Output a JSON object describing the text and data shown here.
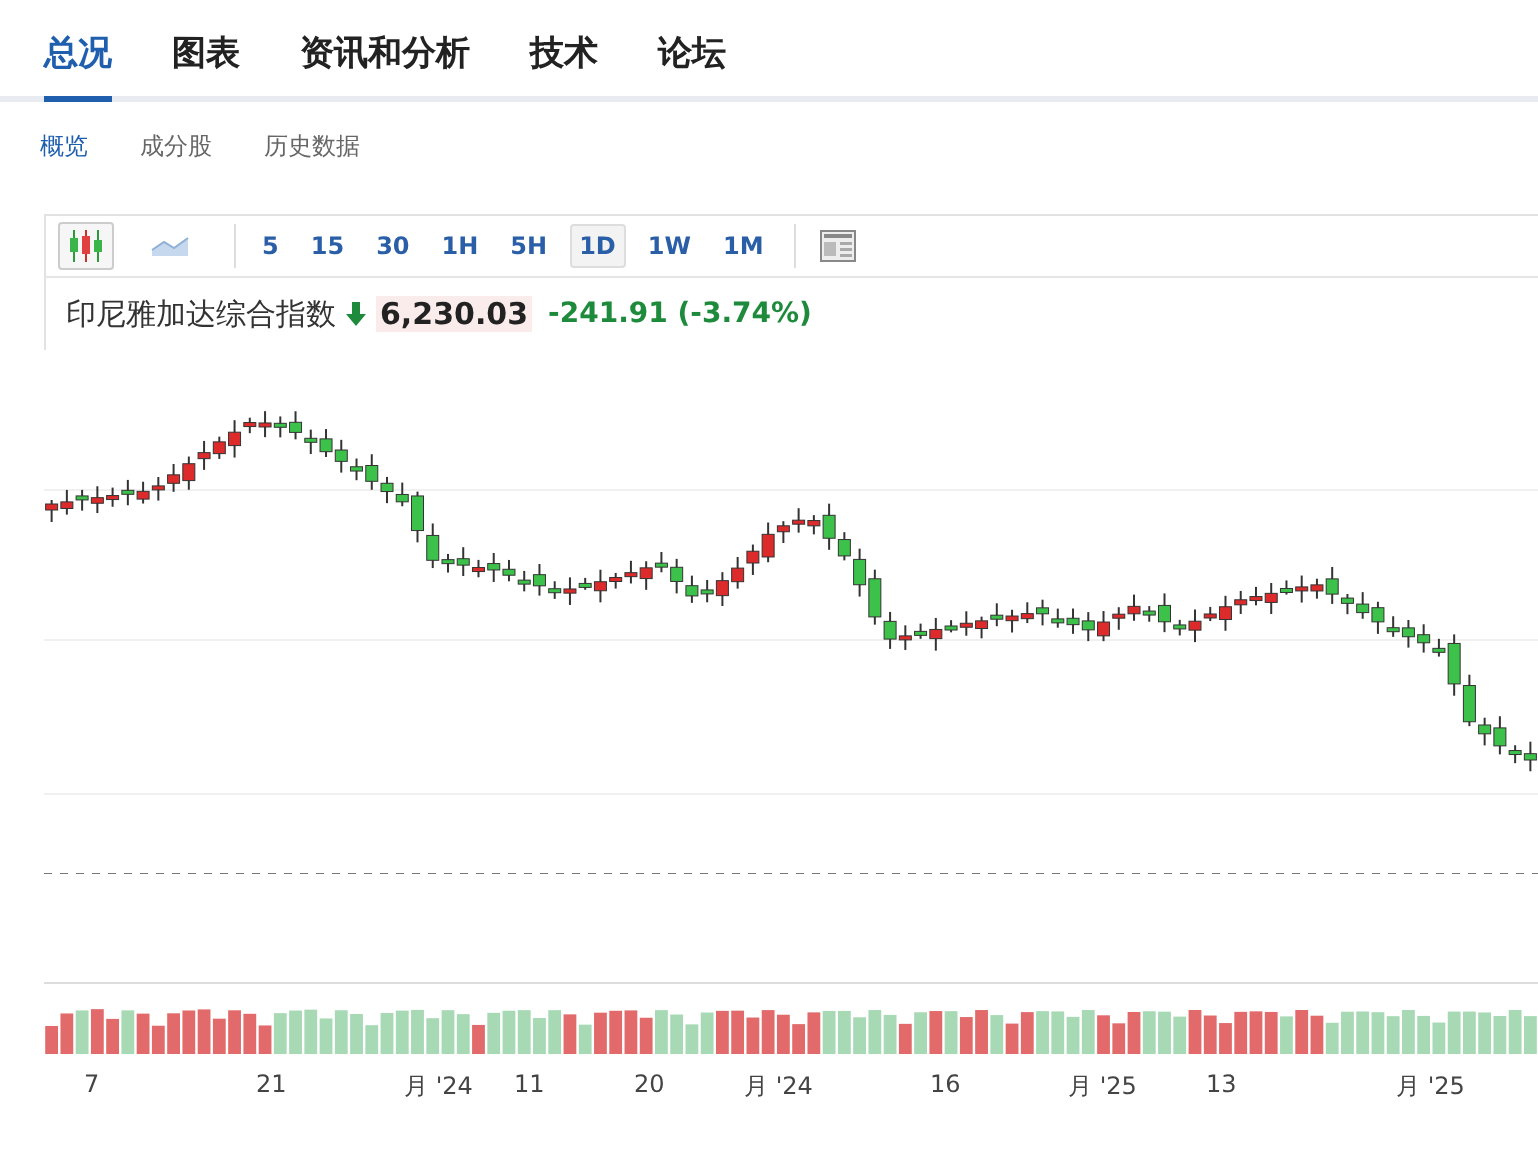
{
  "nav_tabs": [
    {
      "label": "总况",
      "selected": true
    },
    {
      "label": "图表",
      "selected": false
    },
    {
      "label": "资讯和分析",
      "selected": false
    },
    {
      "label": "技术",
      "selected": false
    },
    {
      "label": "论坛",
      "selected": false
    }
  ],
  "sub_tabs": [
    {
      "label": "概览",
      "selected": true
    },
    {
      "label": "成分股",
      "selected": false
    },
    {
      "label": "历史数据",
      "selected": false
    }
  ],
  "toolbar": {
    "chart_types": [
      {
        "kind": "candlestick",
        "selected": true
      },
      {
        "kind": "area",
        "selected": false
      }
    ],
    "intervals": [
      {
        "label": "5",
        "selected": false
      },
      {
        "label": "15",
        "selected": false
      },
      {
        "label": "30",
        "selected": false
      },
      {
        "label": "1H",
        "selected": false
      },
      {
        "label": "5H",
        "selected": false
      },
      {
        "label": "1D",
        "selected": true
      },
      {
        "label": "1W",
        "selected": false
      },
      {
        "label": "1M",
        "selected": false
      }
    ]
  },
  "quote": {
    "name": "印尼雅加达综合指数",
    "price": "6,230.03",
    "change": "-241.91 (-3.74%)"
  },
  "x_axis_labels": [
    "7",
    "21",
    "月 '24",
    "11",
    "20",
    "月 '24",
    "16",
    "月 '25",
    "13",
    "月 '25"
  ]
}
